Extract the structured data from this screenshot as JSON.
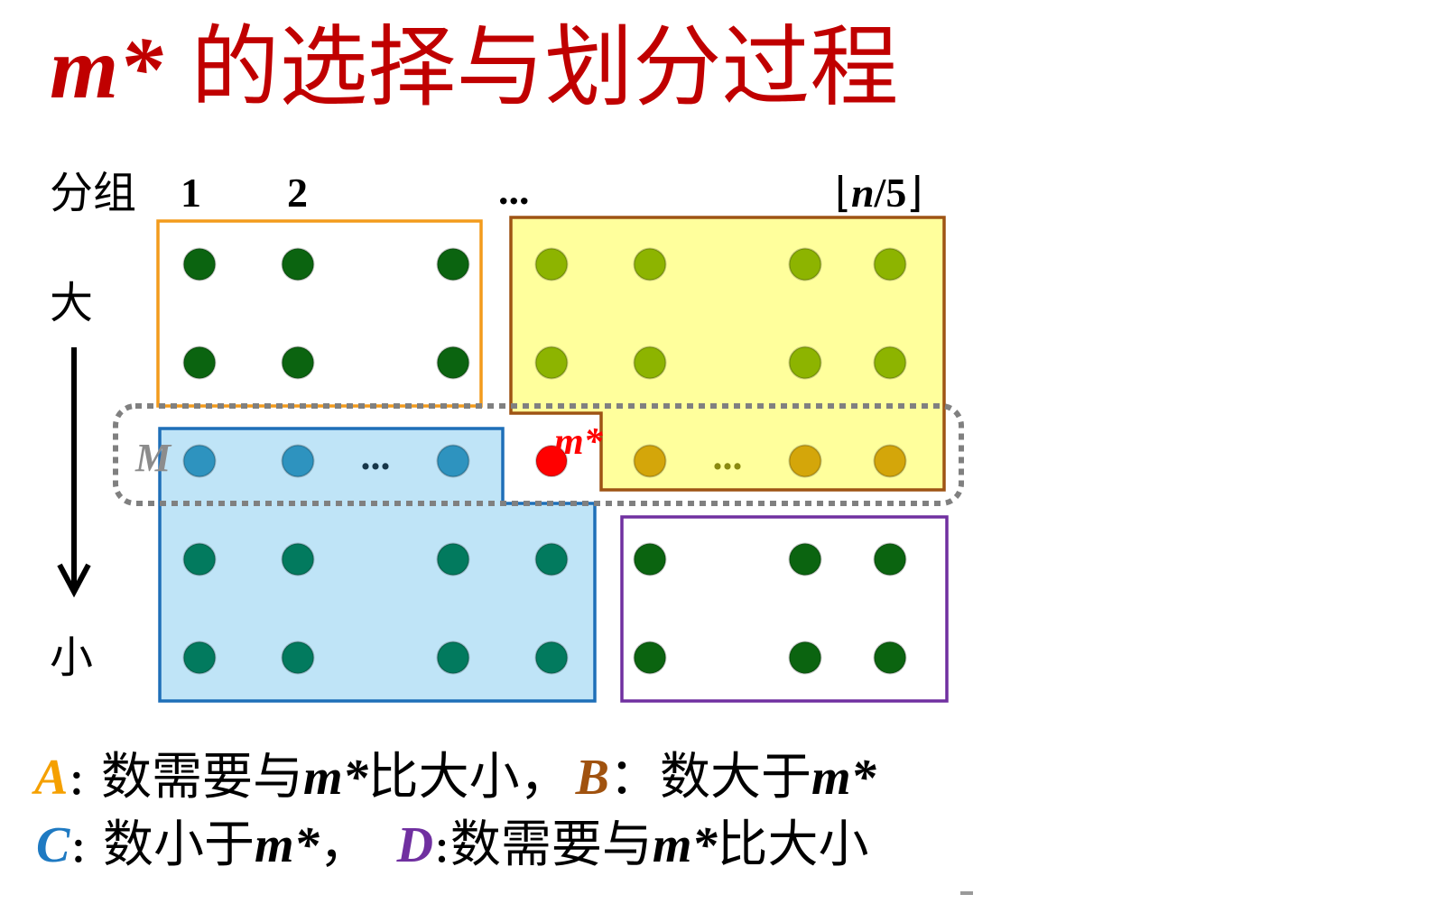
{
  "title": {
    "math": "m*",
    "text": "的选择与划分过程"
  },
  "header": {
    "group_label": "分组",
    "group_1": "1",
    "group_2": "2",
    "ellipsis": "...",
    "last_open": "⌊",
    "last_n": "n",
    "last_rest": "/5",
    "last_close": "⌋"
  },
  "axis": {
    "top": "大",
    "bottom": "小"
  },
  "labels": {
    "median_row": "M",
    "pivot": "m*"
  },
  "colors": {
    "title": "#C00000",
    "region_A": "#F39B1C",
    "region_B_stroke": "#9E5414",
    "region_B_fill": "#FFFF9C",
    "region_C_stroke": "#1E6FB8",
    "region_C_fill": "#BFE4F7",
    "region_D": "#7030A0",
    "median_box": "#808080",
    "median_label": "#8C8C8C",
    "pivot": "#FF0000",
    "legend_A": "#F5A000",
    "legend_B": "#A0520F",
    "legend_C": "#1F7AC2",
    "legend_D": "#7030A0"
  },
  "grid": {
    "ellipsis_text": "...",
    "palette": {
      "dark": "#0B6410",
      "olive": "#8DB400",
      "blue": "#2E93BF",
      "red": "#FF0000",
      "gold": "#D4A60A",
      "teal": "#027A5E",
      "ellipsis-dark": "#17374A",
      "ellipsis-olive": "#8A8A10"
    },
    "rows": [
      [
        "dark",
        "dark",
        "",
        "dark",
        "olive",
        "olive",
        "",
        "olive",
        "olive"
      ],
      [
        "dark",
        "dark",
        "",
        "dark",
        "olive",
        "olive",
        "",
        "olive",
        "olive"
      ],
      [
        "blue",
        "blue",
        "ellipsis-dark",
        "blue",
        "red",
        "gold",
        "ellipsis-olive",
        "gold",
        "gold"
      ],
      [
        "teal",
        "teal",
        "",
        "teal",
        "teal",
        "dark",
        "",
        "dark",
        "dark"
      ],
      [
        "teal",
        "teal",
        "",
        "teal",
        "teal",
        "dark",
        "",
        "dark",
        "dark"
      ]
    ]
  },
  "legend": {
    "A": {
      "letter": "A",
      "desc_before": ": 数需要与",
      "math": "m*",
      "desc_after": "比大小，"
    },
    "B": {
      "letter": "B",
      "desc_before": "：数大于",
      "math": "m*"
    },
    "C": {
      "letter": "C",
      "desc_before": ": 数小于",
      "math": "m*",
      "desc_after": "，"
    },
    "D": {
      "letter": "D",
      "desc_before": ":数需要与",
      "math": "m*",
      "desc_after": "比大小"
    }
  }
}
